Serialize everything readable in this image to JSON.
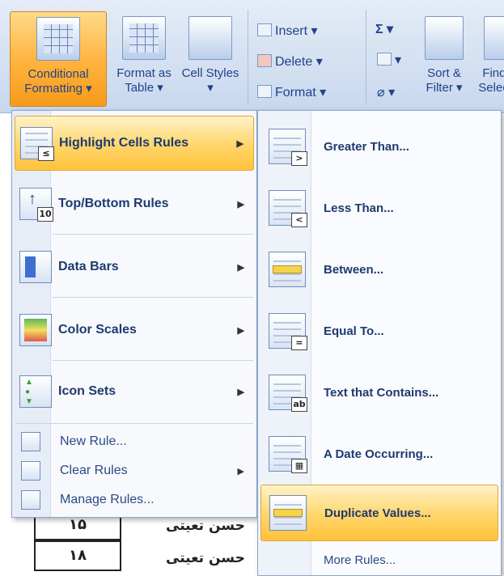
{
  "ribbon": {
    "conditional_formatting": "Conditional Formatting ▾",
    "format_as_table": "Format as Table ▾",
    "cell_styles": "Cell Styles ▾",
    "insert": "Insert ▾",
    "delete": "Delete ▾",
    "format": "Format ▾",
    "sum_symbol": "Σ ▾",
    "sort_filter": "Sort & Filter ▾",
    "find_select": "Find & Select ▾"
  },
  "menu": {
    "items": [
      {
        "label": "Highlight Cells Rules",
        "icon": "highlight-cells-icon",
        "badge": "≤"
      },
      {
        "label": "Top/Bottom Rules",
        "icon": "top-bottom-icon",
        "badge": "10"
      },
      {
        "label": "Data Bars",
        "icon": "data-bars-icon"
      },
      {
        "label": "Color Scales",
        "icon": "color-scales-icon"
      },
      {
        "label": "Icon Sets",
        "icon": "icon-sets-icon"
      }
    ],
    "new_rule": "New Rule...",
    "clear_rules": "Clear Rules",
    "manage_rules": "Manage Rules..."
  },
  "submenu": {
    "items": [
      {
        "label": "Greater Than...",
        "badge": ">"
      },
      {
        "label": "Less Than...",
        "badge": "<"
      },
      {
        "label": "Between...",
        "badge": ""
      },
      {
        "label": "Equal To...",
        "badge": "="
      },
      {
        "label": "Text that Contains...",
        "badge": "ab"
      },
      {
        "label": "A Date Occurring...",
        "badge": "▦"
      },
      {
        "label": "Duplicate Values...",
        "badge": ""
      }
    ],
    "more_rules": "More Rules..."
  },
  "sheet": {
    "rows": [
      {
        "num": "۱۵",
        "name": "حسن تعیتی"
      },
      {
        "num": "۱۸",
        "name": "حسن تعیتی"
      }
    ]
  },
  "colors": {
    "highlight": "#ffc23a",
    "ribbon": "#d3e0f1",
    "text": "#1e3a6e"
  }
}
